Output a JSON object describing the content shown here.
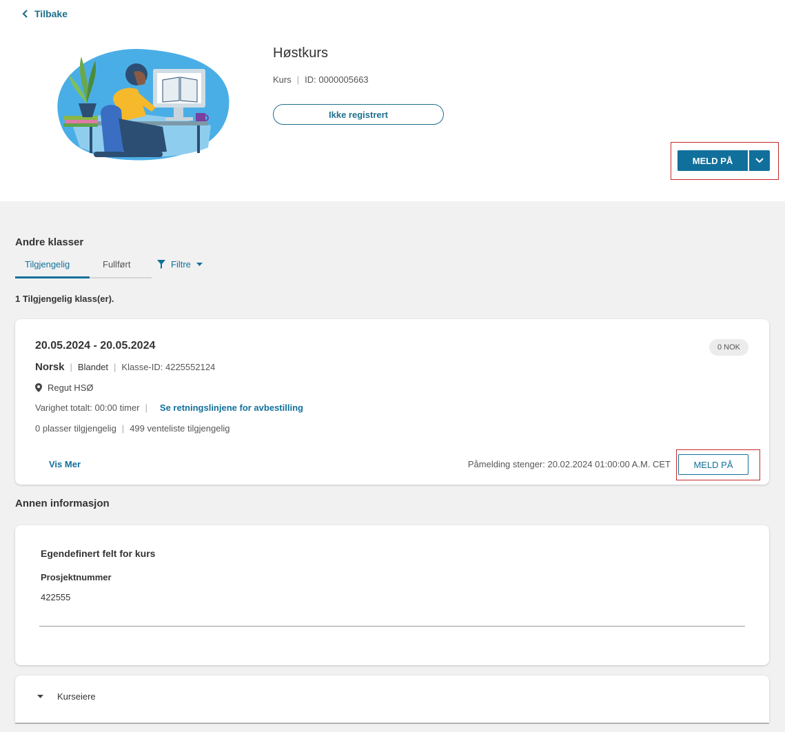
{
  "nav": {
    "back_label": "Tilbake"
  },
  "course": {
    "title": "Høstkurs",
    "type": "Kurs",
    "id_label": "ID: 0000005663",
    "status": "Ikke registrert"
  },
  "enroll": {
    "label": "MELD PÅ",
    "caret_icon": "chevron-down-icon",
    "color": "#11709b"
  },
  "other_classes": {
    "heading": "Andre klasser",
    "tabs": [
      {
        "label": "Tilgjengelig",
        "active": true
      },
      {
        "label": "Fullført",
        "active": false
      }
    ],
    "filter_label": "Filtre",
    "count_text": "1 Tilgjengelig klass(er).",
    "class": {
      "date_range": "20.05.2024 - 20.05.2024",
      "price": "0 NOK",
      "language": "Norsk",
      "format": "Blandet",
      "class_id": "Klasse-ID: 4225552124",
      "location": "Regut HSØ",
      "duration": "Varighet totalt: 00:00 timer",
      "cancellation_link": "Se retningslinjene for avbestilling",
      "seats": "0 plasser tilgjengelig",
      "waitlist": "499 venteliste tilgjengelig",
      "more_label": "Vis Mer",
      "closing": "Påmelding stenger: 20.02.2024 01:00:00 A.M. CET",
      "enroll_label": "MELD PÅ"
    }
  },
  "other_info": {
    "heading": "Annen informasjon",
    "custom_field_title": "Egendefinert felt for kurs",
    "field_label": "Prosjektnummer",
    "field_value": "422555",
    "owners_label": "Kurseiere"
  },
  "colors": {
    "accent": "#11709b",
    "highlight": "#c62828",
    "section_bg": "#f1f1f1"
  }
}
